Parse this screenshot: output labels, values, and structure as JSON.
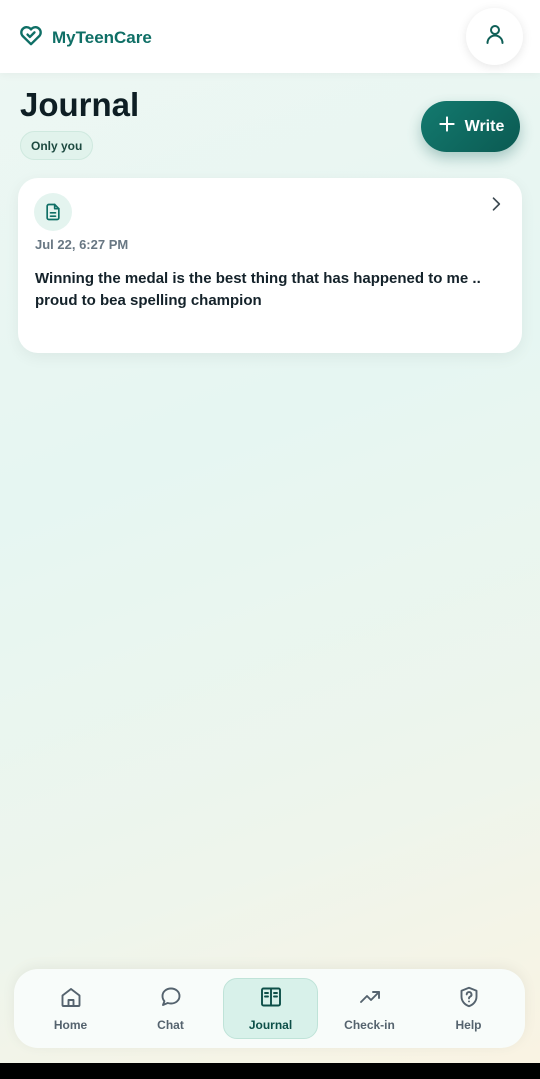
{
  "app": {
    "name": "MyTeenCare"
  },
  "colors": {
    "brand": "#0f6f66",
    "accent_dark": "#0b5a52",
    "active_tab_bg": "#d8f1ea"
  },
  "header": {
    "brand_icon": "heart-check-icon",
    "profile_icon": "user-icon"
  },
  "page": {
    "title": "Journal",
    "privacy_badge": "Only you",
    "write_button": {
      "label": "Write",
      "icon": "plus-icon"
    }
  },
  "entries": [
    {
      "icon": "document-icon",
      "date": "Jul 22, 6:27 PM",
      "text": "Winning the medal is the best thing that has happened to me .. proud to bea spelling champion",
      "chevron": "chevron-right-icon"
    }
  ],
  "nav": {
    "active": "Journal",
    "items": [
      {
        "label": "Home",
        "icon": "home-icon"
      },
      {
        "label": "Chat",
        "icon": "chat-bubble-icon"
      },
      {
        "label": "Journal",
        "icon": "book-open-icon"
      },
      {
        "label": "Check-in",
        "icon": "trend-up-icon"
      },
      {
        "label": "Help",
        "icon": "shield-question-icon"
      }
    ]
  }
}
